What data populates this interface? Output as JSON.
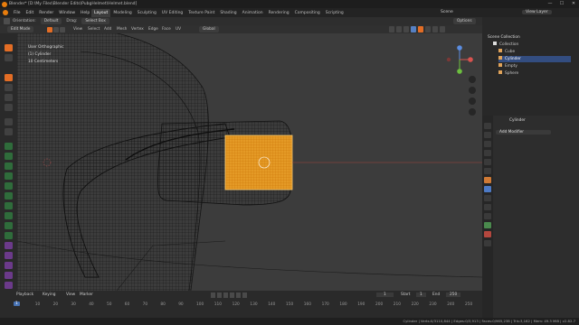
{
  "window": {
    "title": "Blender* [D:\\My Files\\Blender Edits\\PubgHelmet\\Helmet.blend]",
    "min": "—",
    "max": "☐",
    "close": "✕"
  },
  "menu": [
    "File",
    "Edit",
    "Render",
    "Window",
    "Help"
  ],
  "workspaces": [
    "Layout",
    "Modeling",
    "Sculpting",
    "UV Editing",
    "Texture Paint",
    "Shading",
    "Animation",
    "Rendering",
    "Compositing",
    "Scripting"
  ],
  "active_workspace": "Layout",
  "scene": {
    "label": "Scene",
    "view_layer": "View Layer"
  },
  "header": {
    "orientation_label": "Orientation:",
    "orientation": "Global",
    "drag_label": "Drag:",
    "drag": "Select Box",
    "default": "Default",
    "options": "Options"
  },
  "editor": {
    "mode": "Edit Mode",
    "menus": [
      "View",
      "Select",
      "Add",
      "Mesh",
      "Vertex",
      "Edge",
      "Face",
      "UV"
    ],
    "global": "Global"
  },
  "overlay": {
    "view": "User Orthographic",
    "object": "(1) Cylinder",
    "units": "10 Centimeters"
  },
  "outliner": {
    "title": "Scene Collection",
    "items": [
      {
        "name": "Collection",
        "depth": 1
      },
      {
        "name": "Cube",
        "depth": 2
      },
      {
        "name": "Cylinder",
        "depth": 2,
        "selected": true
      },
      {
        "name": "Empty",
        "depth": 2
      },
      {
        "name": "Sphere",
        "depth": 2
      }
    ]
  },
  "properties": {
    "object": "Cylinder",
    "add_modifier": "Add Modifier"
  },
  "timeline": {
    "playback": "Playback",
    "keying": "Keying",
    "view": "View",
    "marker": "Marker",
    "current": "1",
    "start_label": "Start",
    "start": "1",
    "end_label": "End",
    "end": "250",
    "ticks": [
      "1",
      "10",
      "20",
      "30",
      "40",
      "50",
      "60",
      "70",
      "80",
      "90",
      "100",
      "110",
      "120",
      "130",
      "140",
      "150",
      "160",
      "170",
      "180",
      "190",
      "200",
      "210",
      "220",
      "230",
      "240",
      "250"
    ]
  },
  "status": {
    "text": "Cylinder | Verts:0/3110,844 | Edges:0/3,913 | Faces:0/965,238 | Tris:3,162 | Mem: 49.3 MiB | v2.82.7"
  },
  "colors": {
    "accent": "#e87d0d",
    "selection": "#f3a325",
    "wire": "#101010"
  }
}
